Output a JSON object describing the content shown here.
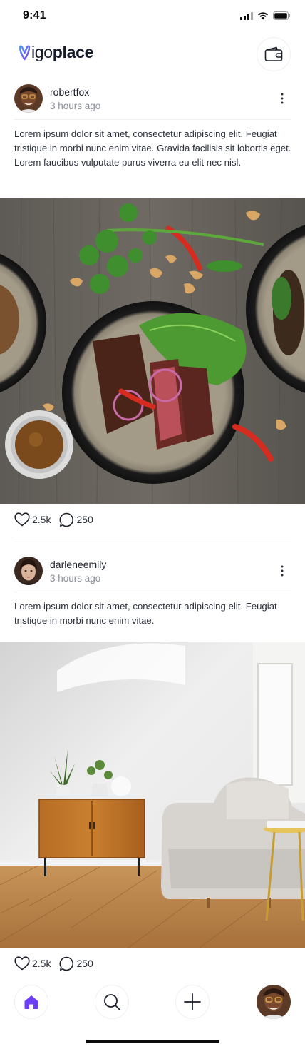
{
  "status_bar": {
    "time": "9:41",
    "icons": [
      "signal-icon",
      "wifi-icon",
      "battery-icon"
    ]
  },
  "app": {
    "logo_light": "igo",
    "logo_bold": "place",
    "logo_accent": "#6c5cf5",
    "header_button_icon": "wallet-icon"
  },
  "posts": [
    {
      "username": "robertfox",
      "time": "3 hours ago",
      "text": "Lorem ipsum dolor sit amet, consectetur adipiscing elit. Feugiat tristique in morbi nunc enim vitae. Gravida facilisis sit lobortis eget. Lorem faucibus vulputate purus viverra eu elit nec nisl.",
      "image": "food-photo",
      "likes": "2.5k",
      "comments": "250"
    },
    {
      "username": "darleneemily",
      "time": "3 hours ago",
      "text": "Lorem ipsum dolor sit amet, consectetur adipiscing elit. Feugiat tristique in morbi nunc enim vitae.",
      "image": "living-room-photo",
      "likes": "2.5k",
      "comments": "250"
    }
  ],
  "tab_bar": {
    "items": [
      "home-icon",
      "search-icon",
      "plus-icon",
      "profile-avatar"
    ],
    "active": "home-icon",
    "active_color": "#6c3ef5"
  }
}
